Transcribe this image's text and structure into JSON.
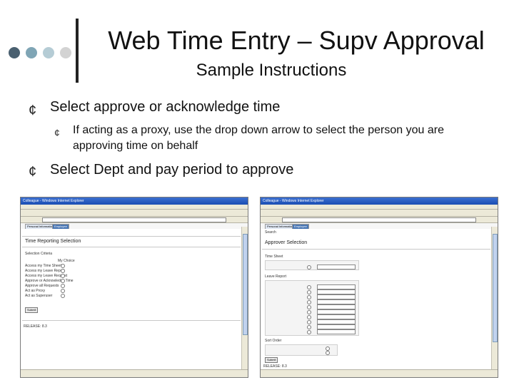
{
  "slide": {
    "title": "Web Time Entry – Supv Approval",
    "subtitle": "Sample Instructions",
    "bullets": [
      {
        "text": "Select approve or acknowledge time",
        "sub": "If acting as a proxy, use the drop down arrow to select the person you are approving time on behalf"
      },
      {
        "text": "Select Dept and pay period to approve"
      }
    ],
    "dot_colors": [
      "#4a6070",
      "#7fa5b5",
      "#b5ccd5",
      "#d3d3d3"
    ],
    "bullet_glyph": "¢"
  },
  "left_screenshot": {
    "window_title": "Colleague - Windows Internet Explorer",
    "tabs": [
      "Personal Information",
      "Employee"
    ],
    "page_title": "Time Reporting Selection",
    "section_label": "Selection Criteria",
    "column_header": "My Choice",
    "options": [
      "Access my Time Sheet",
      "Access my Leave Report",
      "Access my Leave Request",
      "Approve or Acknowledge Time",
      "Approve all Requests",
      "Act as Proxy",
      "Act as Superuser"
    ],
    "submit_label": "Submit",
    "release": "RELEASE: 8.3"
  },
  "right_screenshot": {
    "window_title": "Colleague - Windows Internet Explorer",
    "tabs": [
      "Personal Information",
      "Employee"
    ],
    "search_label": "Search",
    "page_title": "Approver Selection",
    "time_sheet_label": "Time Sheet",
    "leave_report_label": "Leave Report",
    "sort_label": "Sort Order",
    "submit_label": "Submit",
    "release": "RELEASE: 8.3"
  }
}
